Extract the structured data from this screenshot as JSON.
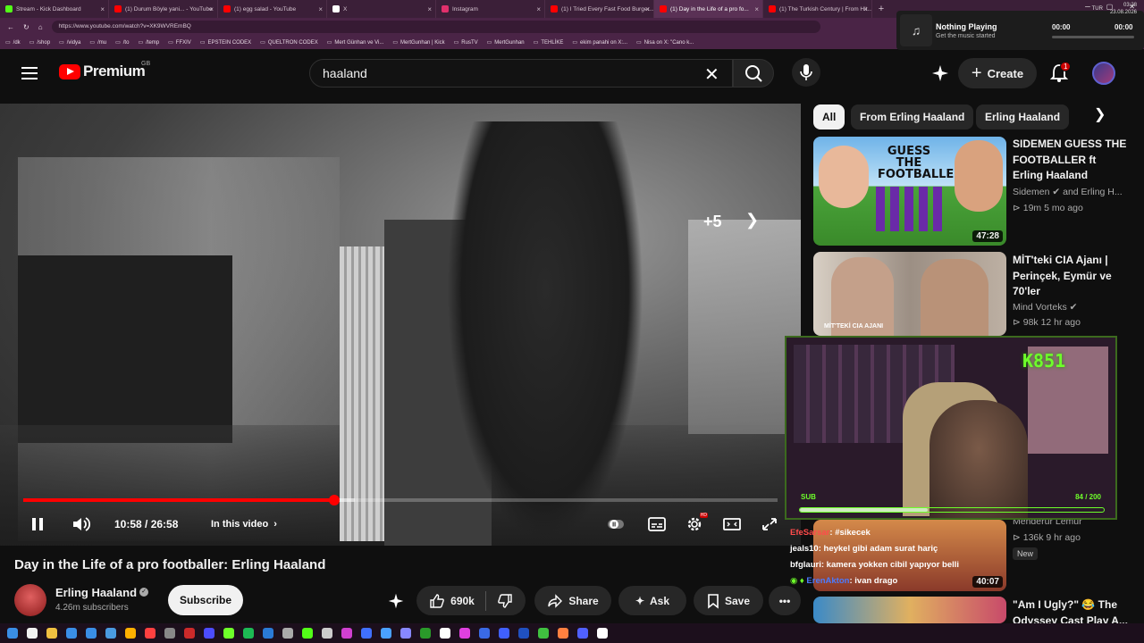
{
  "browser": {
    "tabs": [
      {
        "label": "Stream - Kick Dashboard",
        "color": "#53fc18"
      },
      {
        "label": "(1) Durum Böyle yani...  - YouTube",
        "color": "#ff0000"
      },
      {
        "label": "(1) egg salad - YouTube",
        "color": "#ff0000"
      },
      {
        "label": "X",
        "color": "#ffffff"
      },
      {
        "label": "Instagram",
        "color": "#e1306c"
      },
      {
        "label": "(1) I Tried Every Fast Food Burger...",
        "color": "#ff0000"
      },
      {
        "label": "(1) Day in the Life of a pro fo...",
        "color": "#ff0000",
        "active": true
      },
      {
        "label": "(1) The Turkish Century | From Hit...",
        "color": "#ff0000"
      }
    ],
    "url": "https://www.youtube.com/watch?v=XK9WVREmBQ",
    "bookmarks": [
      "/dk",
      "/shop",
      "/vidya",
      "/mu",
      "/to",
      "/temp",
      "FFXIV",
      "EPSTEIN CODEX",
      "QUELTRON CODEX",
      "Mert Günhan ve Vi...",
      "MertGunhan | Kick",
      "RusTV",
      "MertGunhan",
      "TEHLİKE",
      "ekim panahi on X:...",
      "Nisa on X: \"Cano k..."
    ]
  },
  "music": {
    "title": "Nothing Playing",
    "subtitle": "Get the music started",
    "time_start": "00:00",
    "time_end": "00:00"
  },
  "header": {
    "logo_text": "Premium",
    "region": "GB",
    "search_value": "haaland",
    "create_label": "Create",
    "notifications": "1"
  },
  "player": {
    "skip_label": "+5",
    "time": "10:58 / 26:58",
    "in_video_label": "In this video",
    "progress": 0.412,
    "buffered": 0.44
  },
  "video": {
    "title": "Day in the Life of a pro footballer: Erling Haaland",
    "channel": "Erling Haaland",
    "subscribers": "4.26m subscribers",
    "subscribe_label": "Subscribe",
    "likes": "690k",
    "share_label": "Share",
    "ask_label": "Ask",
    "save_label": "Save"
  },
  "chips": [
    "All",
    "From Erling Haaland",
    "Erling Haaland"
  ],
  "recommendations": [
    {
      "title": "SIDEMEN GUESS THE FOOTBALLER ft Erling Haaland",
      "channel": "Sidemen",
      "channel_extra": "and Erling H...",
      "meta": "19m   5 mo ago",
      "duration": "47:28",
      "thumb_text": "GUESS THE FOOTBALLER"
    },
    {
      "title": "MİT'teki CIA Ajanı | Perinçek, Eymür ve 70'ler",
      "channel": "Mind Vorteks",
      "meta": "98k   12 hr ago",
      "duration": "",
      "thumb_text": "MİT'TEKİ CIA AJANI"
    },
    {
      "title": "",
      "channel": "Menderur Lemur",
      "meta": "136k   9 hr ago",
      "badge": "New",
      "duration": "40:07"
    },
    {
      "title": "\"Am I Ugly?\" 😂 The Odyssey Cast Play A...",
      "channel": "",
      "meta": "",
      "duration": ""
    }
  ],
  "stream": {
    "logo": "K851",
    "sub_label": "SUB",
    "sub_count": "84 / 200",
    "sub_progress": 0.42
  },
  "chat": [
    {
      "user": "EfeSarsar",
      "message": "#sikecek"
    },
    {
      "user": "jeals10",
      "message": "heykel gibi adam surat hariç"
    },
    {
      "user": "bfglauri",
      "message": "kamera yokken cibil yapıyor belli"
    },
    {
      "user": "ErenAkton",
      "message": "ivan drago"
    }
  ],
  "tray": {
    "lang": "TUR",
    "time": "03:28",
    "date": "23.08.2026"
  }
}
